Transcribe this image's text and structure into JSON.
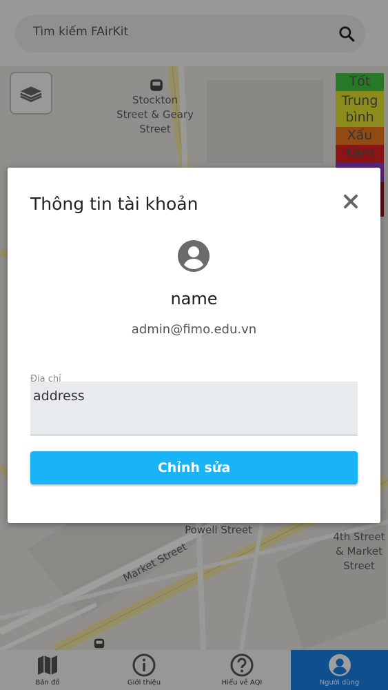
{
  "search": {
    "placeholder": "Tìm kiếm FAirKit"
  },
  "map": {
    "labels": {
      "stockton": "Stockton\nStreet & Geary\nStreet",
      "powell": "Powell Street",
      "market": "Market Street",
      "fourth": "4th Street\n& Market\nStreet"
    }
  },
  "legend": {
    "items": [
      {
        "label": "Tốt",
        "color": "#3fc33f"
      },
      {
        "label": "Trung bình",
        "color": "#e3e32f"
      },
      {
        "label": "Xấu",
        "color": "#e8781e"
      },
      {
        "label": "Kém",
        "color": "#e02222"
      }
    ]
  },
  "modal": {
    "title": "Thông tin tài khoản",
    "name": "name",
    "email": "admin@fimo.edu.vn",
    "address_label": "Địa chỉ",
    "address_value": "address",
    "edit_label": "Chỉnh sửa"
  },
  "nav": {
    "items": [
      {
        "label": "Bản đồ",
        "icon": "map-icon"
      },
      {
        "label": "Giới thiệu",
        "icon": "info-icon"
      },
      {
        "label": "Hiểu về AQI",
        "icon": "help-icon"
      },
      {
        "label": "Người dùng",
        "icon": "user-icon"
      }
    ]
  },
  "colors": {
    "primary": "#19b4f5",
    "nav_active": "#1980e6"
  }
}
